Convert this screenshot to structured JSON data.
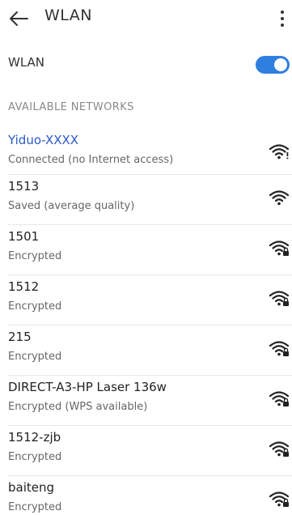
{
  "header": {
    "title": "WLAN"
  },
  "wlan_toggle": {
    "label": "WLAN",
    "enabled": true,
    "accent_color": "#2f7fe0"
  },
  "section": {
    "title": "AVAILABLE NETWORKS"
  },
  "networks": [
    {
      "name": "Yiduo-XXXX",
      "status": "Connected (no Internet access)",
      "icon": "wifi-warning-icon",
      "connected": true
    },
    {
      "name": "1513",
      "status": "Saved (average quality)",
      "icon": "wifi-icon",
      "connected": false
    },
    {
      "name": "1501",
      "status": "Encrypted",
      "icon": "wifi-lock-icon",
      "connected": false
    },
    {
      "name": "1512",
      "status": "Encrypted",
      "icon": "wifi-lock-icon",
      "connected": false
    },
    {
      "name": "215",
      "status": "Encrypted",
      "icon": "wifi-lock-icon",
      "connected": false
    },
    {
      "name": "DIRECT-A3-HP Laser 136w",
      "status": "Encrypted (WPS available)",
      "icon": "wifi-lock-icon",
      "connected": false
    },
    {
      "name": "1512-zjb",
      "status": "Encrypted",
      "icon": "wifi-lock-icon",
      "connected": false
    },
    {
      "name": "baiteng",
      "status": "Encrypted",
      "icon": "wifi-lock-icon",
      "connected": false
    }
  ]
}
